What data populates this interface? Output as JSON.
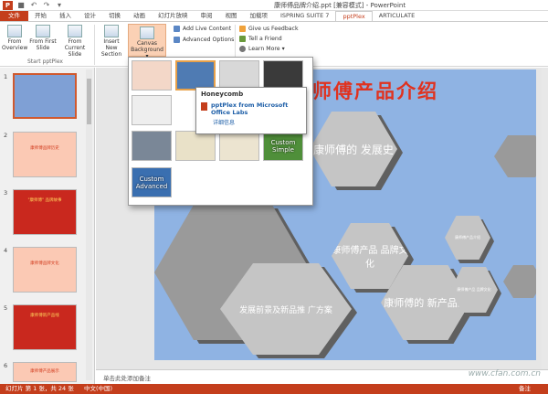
{
  "window": {
    "title": "康师傅品牌介绍.ppt [兼容模式] - PowerPoint",
    "app_icon": "P"
  },
  "quick_access": [
    {
      "icon": "save-icon",
      "glyph": "■"
    },
    {
      "icon": "undo-icon",
      "glyph": "↶"
    },
    {
      "icon": "redo-icon",
      "glyph": "↷"
    },
    {
      "icon": "customize-qat-icon",
      "glyph": "▾"
    }
  ],
  "tabs": [
    {
      "label": "文件",
      "kind": "file"
    },
    {
      "label": "开始"
    },
    {
      "label": "插入"
    },
    {
      "label": "设计"
    },
    {
      "label": "切换"
    },
    {
      "label": "动画"
    },
    {
      "label": "幻灯片放映"
    },
    {
      "label": "审阅"
    },
    {
      "label": "视图"
    },
    {
      "label": "加载项"
    },
    {
      "label": "ISPRING SUITE 7"
    },
    {
      "label": "pptPlex",
      "kind": "active"
    },
    {
      "label": "ARTICULATE"
    }
  ],
  "ribbon": {
    "start_group_label": "Start pptPlex",
    "from_overview": "From Overview",
    "from_first_slide": "From First Slide",
    "from_current_slide": "From Current Slide",
    "insert_new_section": "Insert New Section",
    "canvas_background": "Canvas Background ▾",
    "add_live_content": "Add Live Content",
    "advanced_options": "Advanced Options",
    "give_feedback": "Give us Feedback",
    "tell_a_friend": "Tell a Friend",
    "learn_more": "Learn More ▾"
  },
  "gallery": {
    "items": [
      {
        "label": "",
        "style": "honeycomb-pink"
      },
      {
        "label": "",
        "style": "honeycomb-blue",
        "selected": true
      },
      {
        "label": "",
        "style": "grey-tiles"
      },
      {
        "label": "",
        "style": "dark-people"
      },
      {
        "label": "",
        "style": "grid-white"
      },
      {
        "label": "",
        "style": "hidden"
      },
      {
        "label": "",
        "style": "hidden"
      },
      {
        "label": "",
        "style": "green-board"
      },
      {
        "label": "",
        "style": "blue-slate"
      },
      {
        "label": "",
        "style": "wave"
      },
      {
        "label": "",
        "style": "beige"
      },
      {
        "label": "Custom Simple",
        "style": "green-custom"
      },
      {
        "label": "Custom Advanced",
        "style": "blue-custom"
      }
    ]
  },
  "tooltip": {
    "title": "Honeycomb",
    "source": "pptPlex from Microsoft Office Labs",
    "more_link": "详细信息"
  },
  "thumbnails": [
    {
      "number": "1",
      "caption": ""
    },
    {
      "number": "2",
      "caption": "康师傅品牌历史"
    },
    {
      "number": "3",
      "caption": "\"康师傅\" 品牌故事"
    },
    {
      "number": "4",
      "caption": "康师傅品牌文化"
    },
    {
      "number": "5",
      "caption": "康师傅新产品线"
    },
    {
      "number": "6",
      "caption": "康师傅产品展示"
    }
  ],
  "slide": {
    "title": "康师傅产品介绍",
    "hex_history": "康师傅的 发展史",
    "hex_culture": "康师傅产品 品牌文化",
    "hex_new_products": "康师傅的 新产品线",
    "hex_future": "发展前景及新品推 广方案",
    "hex_small_1": "康师傅产品介绍",
    "hex_small_2": "康师傅产品 品牌文化"
  },
  "notes_placeholder": "单击此处添加备注",
  "status": {
    "slide_info": "幻灯片 第 1 张，共 24 张",
    "language": "中文(中国)",
    "notes": "备注",
    "watermark": "www.cfan.com.cn"
  },
  "colors": {
    "accent": "#c43e1c",
    "slide_bg": "#8fb3e3",
    "hex_fill": "#c5c5c5",
    "hex_shadow": "#606060",
    "title_red": "#e0321f"
  }
}
